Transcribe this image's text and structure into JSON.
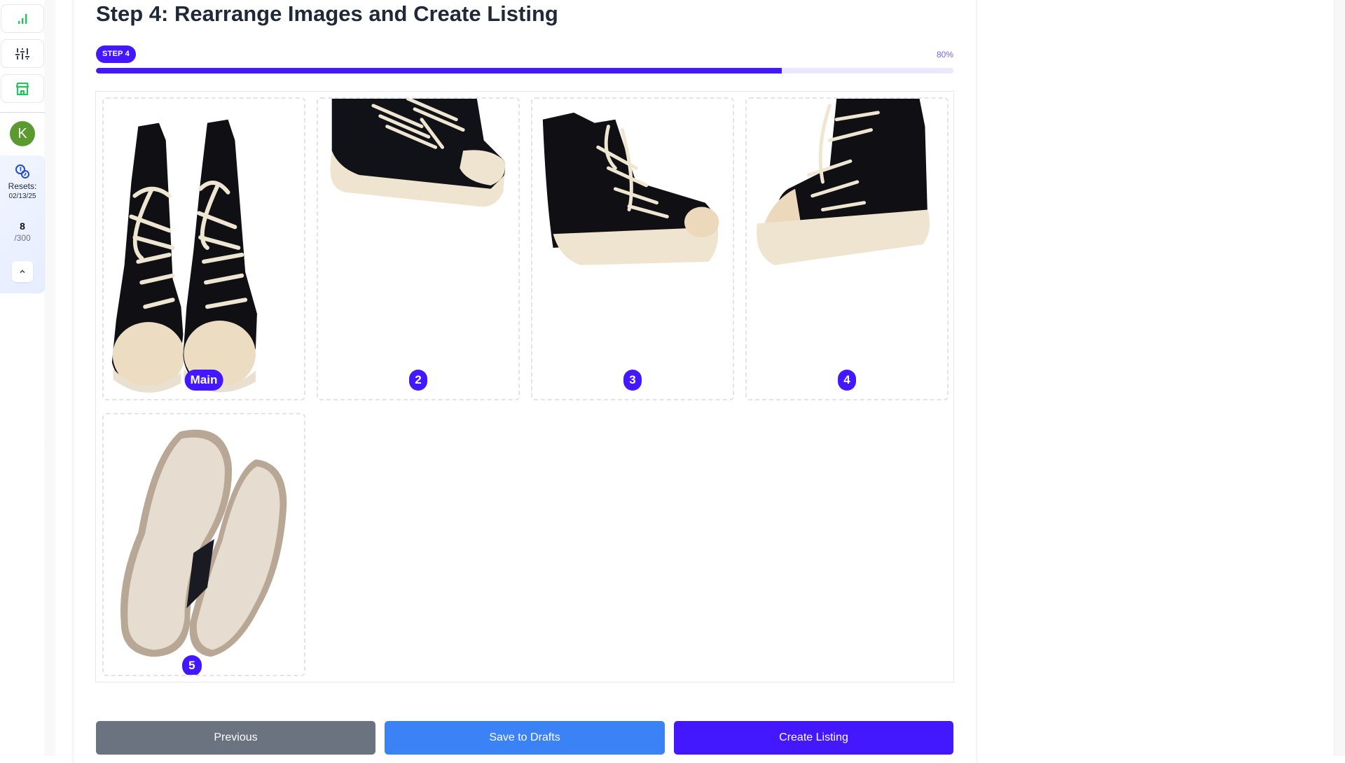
{
  "sidebar": {
    "items": [
      {
        "icon": "bar-chart-icon",
        "color": "#22c55e"
      },
      {
        "icon": "sliders-icon",
        "color": "#374151"
      },
      {
        "icon": "store-icon",
        "color": "#22c55e"
      }
    ],
    "avatar_initial": "K",
    "avatar_color": "#5b9a2f",
    "credits": {
      "icon": "coins-icon",
      "resets_label": "Resets:",
      "resets_date": "02/13/25",
      "used": "8",
      "total": "/300"
    },
    "collapse_icon": "chevron-up-icon"
  },
  "header": {
    "title": "Step 4: Rearrange Images and Create Listing",
    "step_badge": "STEP 4",
    "progress_label": "80%",
    "progress_value": 0.8
  },
  "images": [
    {
      "badge": "Main",
      "description": "Black high-top sneakers, front view"
    },
    {
      "badge": "2",
      "description": "Black high-top sneakers, side view"
    },
    {
      "badge": "3",
      "description": "Black high-top sneakers, three-quarter view"
    },
    {
      "badge": "4",
      "description": "Black high-top sneakers, angled side view"
    },
    {
      "badge": "5",
      "description": "Sneaker soles, bottom view"
    }
  ],
  "actions": {
    "previous_label": "Previous",
    "save_drafts_label": "Save to Drafts",
    "create_listing_label": "Create Listing"
  },
  "colors": {
    "accent": "#4318ff",
    "progress_track": "#ebe7ff",
    "previous_button": "#6b7280",
    "drafts_button": "#3b82f6",
    "title": "#1f2937"
  }
}
